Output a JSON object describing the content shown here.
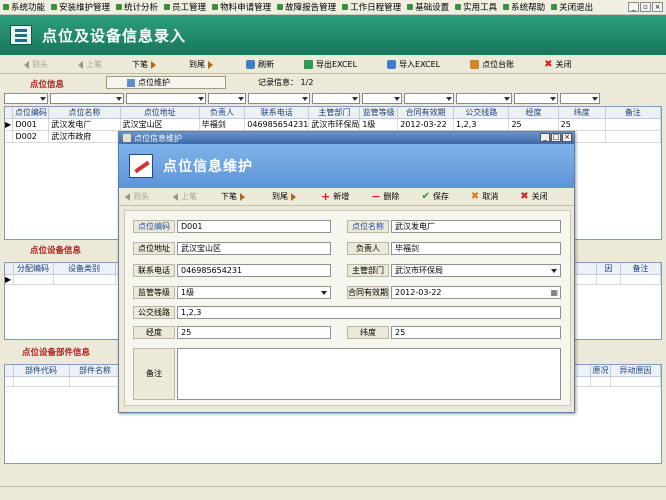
{
  "menu": [
    "系统功能",
    "安装维护管理",
    "统计分析",
    "员工管理",
    "物料申请管理",
    "故障报告管理",
    "工作日程管理",
    "基础设置",
    "实用工具",
    "系统帮助",
    "关闭退出"
  ],
  "banner_title": "点位及设备信息录入",
  "toolbar": {
    "first": "到头",
    "prev": "上笔",
    "next": "下笔",
    "last": "到尾",
    "refresh": "刷新",
    "export": "导出EXCEL",
    "import": "导入EXCEL",
    "ledger": "点位台账",
    "close": "关闭"
  },
  "site_section": {
    "title": "点位信息",
    "tab_label": "点位维护",
    "record_info": "记录信息： 1/2"
  },
  "site_grid": {
    "columns": [
      "点位编码",
      "点位名称",
      "点位地址",
      "负责人",
      "联系电话",
      "主管部门",
      "监管等级",
      "合同有效期",
      "公交线路",
      "经度",
      "纬度",
      "备注"
    ],
    "rows": [
      [
        "D001",
        "武汉发电厂",
        "武汉宝山区",
        "毕福剑",
        "046985654231",
        "武汉市环保局",
        "1级",
        "2012-03-22",
        "1,2,3",
        "25",
        "25",
        ""
      ],
      [
        "D002",
        "武汉市政府",
        "",
        "",
        "",
        "",
        "",
        "",
        "",
        "",
        "",
        ""
      ]
    ]
  },
  "device_section": {
    "title": "点位设备信息",
    "columns": [
      "分配编码",
      "设备类别"
    ],
    "columns_right": [
      "因",
      "备注"
    ]
  },
  "parts_section": {
    "title": "点位设备部件信息",
    "columns": [
      "部件代码",
      "部件名称"
    ],
    "columns_right": [
      "原况",
      "异动原因"
    ]
  },
  "dialog": {
    "window_title": "点位信息维护",
    "banner_title": "点位信息维护",
    "toolbar": {
      "first": "到头",
      "prev": "上笔",
      "next": "下笔",
      "last": "到尾",
      "add": "新增",
      "delete": "删除",
      "save": "保存",
      "cancel": "取消",
      "close": "关闭"
    },
    "fields": {
      "code_label": "点位编码",
      "code": "D001",
      "name_label": "点位名称",
      "name": "武汉发电厂",
      "address_label": "点位地址",
      "address": "武汉宝山区",
      "owner_label": "负责人",
      "owner": "毕福剑",
      "phone_label": "联系电话",
      "phone": "046985654231",
      "dept_label": "主管部门",
      "dept": "武汉市环保局",
      "level_label": "监管等级",
      "level": "1级",
      "contract_label": "合同有效期",
      "contract": "2012-03-22",
      "bus_label": "公交线路",
      "bus": "1,2,3",
      "lng_label": "经度",
      "lng": "25",
      "lat_label": "纬度",
      "lat": "25",
      "remark_label": "备注",
      "remark": ""
    }
  }
}
